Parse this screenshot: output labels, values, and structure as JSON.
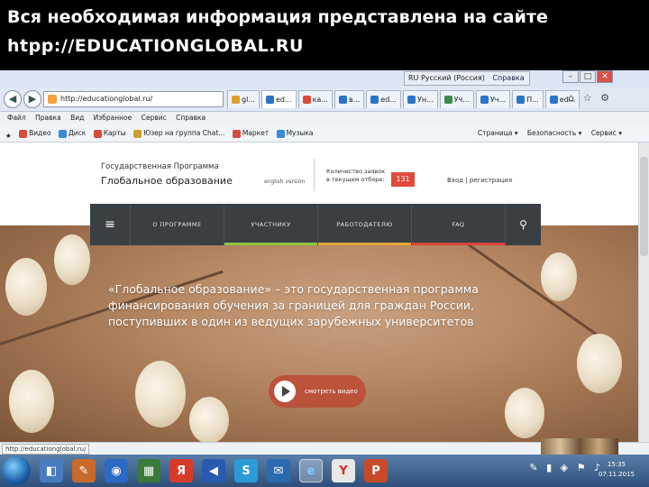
{
  "slide": {
    "line1": "Вся необходимая информация представлена на сайте",
    "line2": "htpp://EDUCATIONGLOBAL.RU"
  },
  "browser": {
    "url": "http://educationglobal.ru/",
    "lang_indicator": "RU Русский (Россия)",
    "help_label": "Справка",
    "tabs": [
      {
        "label": "gl...",
        "color": "#e0a030"
      },
      {
        "label": "ed...",
        "color": "#2a76c6"
      },
      {
        "label": "ка...",
        "color": "#d84a3a"
      },
      {
        "label": "в...",
        "color": "#2a76c6"
      },
      {
        "label": "ed...",
        "color": "#2a76c6"
      },
      {
        "label": "Ун...",
        "color": "#2a76c6"
      },
      {
        "label": "Уч...",
        "color": "#3a8a4a"
      },
      {
        "label": "Уч...",
        "color": "#2a76c6"
      },
      {
        "label": "П...",
        "color": "#2a76c6"
      },
      {
        "label": "ed...",
        "color": "#2a76c6"
      }
    ],
    "menu": [
      "Файл",
      "Правка",
      "Вид",
      "Избранное",
      "Сервис",
      "Справка"
    ],
    "favorites": [
      {
        "label": "Видео",
        "color": "#d84a3a"
      },
      {
        "label": "Диск",
        "color": "#3a8ad8"
      },
      {
        "label": "Карты",
        "color": "#d84a3a"
      },
      {
        "label": "Юзер на группа Chat...",
        "color": "#c9a030"
      },
      {
        "label": "Маркет",
        "color": "#d84a3a"
      },
      {
        "label": "Музыка",
        "color": "#3a8ad8"
      }
    ],
    "commands": [
      "Страница ▾",
      "Безопасность ▾",
      "Сервис ▾"
    ],
    "status_url": "http://educationglobal.ru/"
  },
  "site": {
    "program_line1": "Государственная Программа",
    "program_line2": "Глобальное образование",
    "english": "english version",
    "count_label_1": "Количество заявок",
    "count_label_2": "в текущем отборе:",
    "count_value": "131",
    "login": "Вход  |  регистрация",
    "nav": [
      {
        "label": "О ПРОГРАММЕ",
        "color": "#3a3f43"
      },
      {
        "label": "УЧАСТНИКУ",
        "color": "#8cc63f"
      },
      {
        "label": "РАБОТОДАТЕЛЮ",
        "color": "#e8a33a"
      },
      {
        "label": "FAQ",
        "color": "#d8453a"
      }
    ],
    "hero_lines": [
      "«Глобальное образование» – это государственная программа",
      "финансирования обучения за границей для граждан России,",
      "поступивших в один из ведущих зарубежных университетов"
    ],
    "video_label": "смотреть видео"
  },
  "taskbar": {
    "clock_time": "15:35",
    "clock_date": "07.11.2015"
  }
}
